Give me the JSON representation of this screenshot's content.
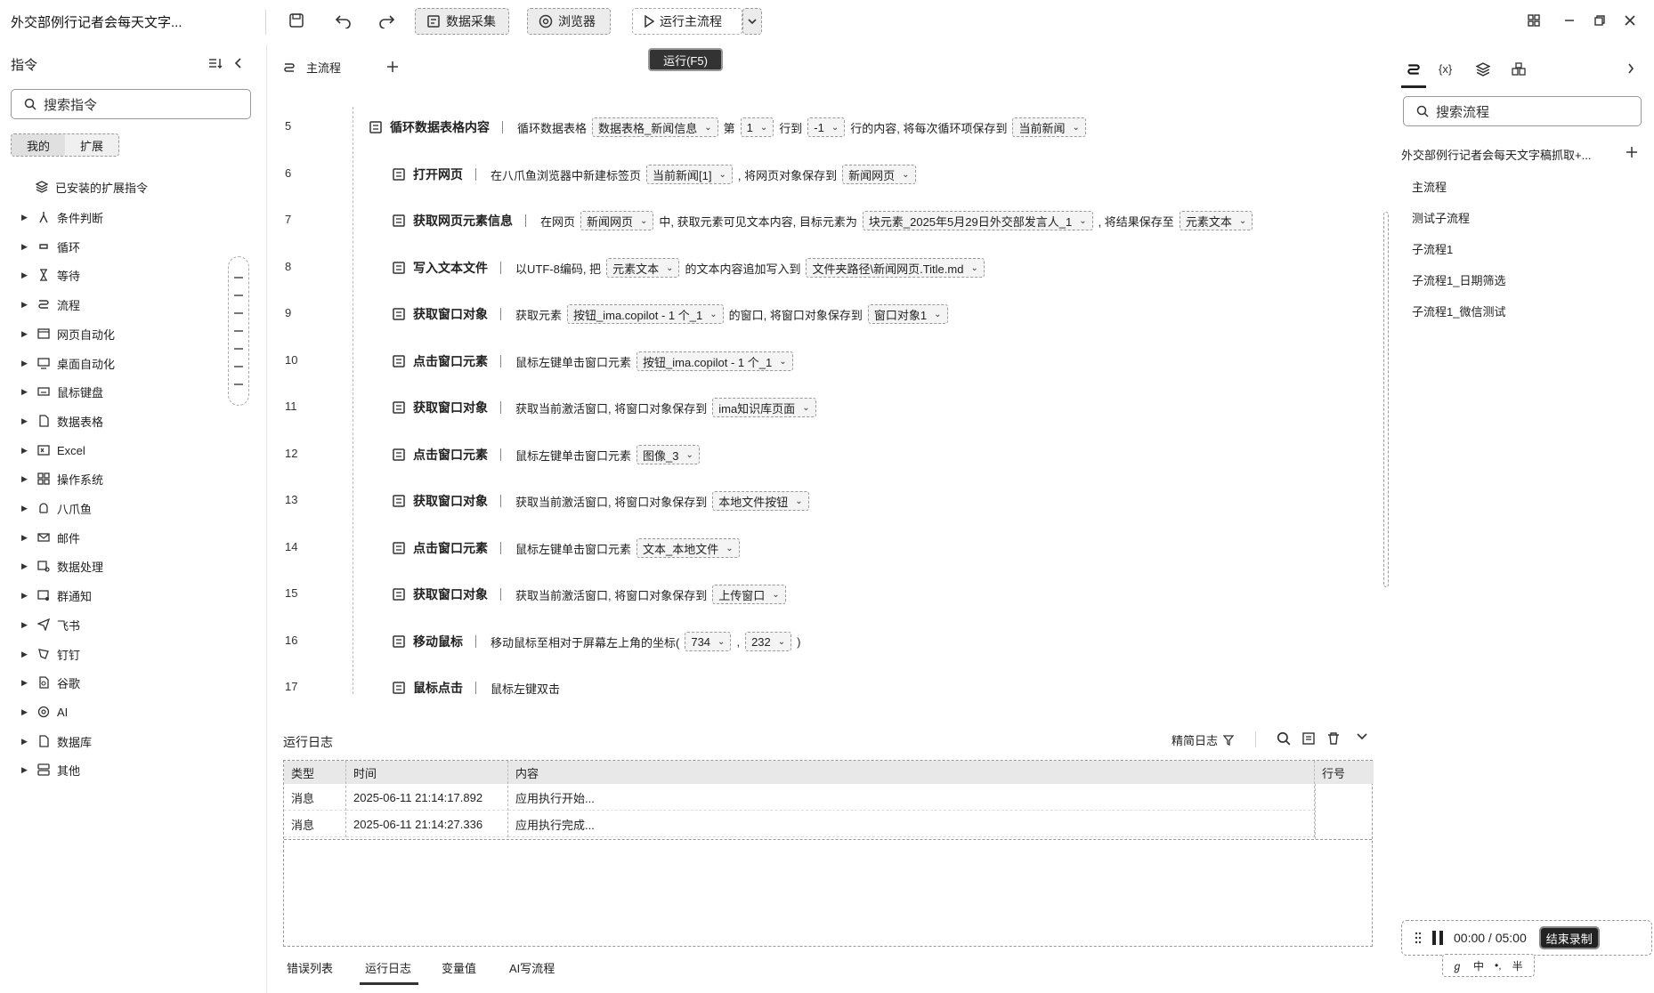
{
  "app": {
    "title": "外交部例行记者会每天文字..."
  },
  "toolbar": {
    "data_collect": "数据采集",
    "browser": "浏览器",
    "run_main": "运行主流程",
    "tooltip": "运行(F5)"
  },
  "left": {
    "header": "指令",
    "search_placeholder": "搜索指令",
    "tabs": [
      "我的",
      "扩展"
    ],
    "installed": "已安装的扩展指令",
    "items": [
      "条件判断",
      "循环",
      "等待",
      "流程",
      "网页自动化",
      "桌面自动化",
      "鼠标键盘",
      "数据表格",
      "Excel",
      "操作系统",
      "八爪鱼",
      "邮件",
      "数据处理",
      "群通知",
      "飞书",
      "钉钉",
      "谷歌",
      "AI",
      "数据库",
      "其他"
    ]
  },
  "main": {
    "tab": "主流程",
    "steps": [
      {
        "n": "5",
        "name": "循环数据表格内容",
        "t1": "循环数据表格",
        "p1": "数据表格_新闻信息",
        "t2": "第",
        "p2": "1",
        "t3": "行到",
        "p3": "-1",
        "t4": "行的内容, 将每次循环项保存到",
        "p4": "当前新闻"
      },
      {
        "n": "6",
        "name": "打开网页",
        "t1": "在八爪鱼浏览器中新建标签页",
        "p1": "当前新闻[1]",
        "t2": ", 将网页对象保存到",
        "p2": "新闻网页"
      },
      {
        "n": "7",
        "name": "获取网页元素信息",
        "t1": "在网页",
        "p1": "新闻网页",
        "t2": "中, 获取元素可见文本内容, 目标元素为",
        "p2": "块元素_2025年5月29日外交部发言人_1",
        "t3": ", 将结果保存至",
        "p3": "元素文本"
      },
      {
        "n": "8",
        "name": "写入文本文件",
        "t1": "以UTF-8编码, 把",
        "p1": "元素文本",
        "t2": "的文本内容追加写入到",
        "p2": "文件夹路径\\新闻网页.Title.md"
      },
      {
        "n": "9",
        "name": "获取窗口对象",
        "t1": "获取元素",
        "p1": "按钮_ima.copilot - 1 个_1",
        "t2": "的窗口, 将窗口对象保存到",
        "p2": "窗口对象1"
      },
      {
        "n": "10",
        "name": "点击窗口元素",
        "t1": "鼠标左键单击窗口元素",
        "p1": "按钮_ima.copilot - 1 个_1"
      },
      {
        "n": "11",
        "name": "获取窗口对象",
        "t1": "获取当前激活窗口, 将窗口对象保存到",
        "p1": "ima知识库页面"
      },
      {
        "n": "12",
        "name": "点击窗口元素",
        "t1": "鼠标左键单击窗口元素",
        "p1": "图像_3"
      },
      {
        "n": "13",
        "name": "获取窗口对象",
        "t1": "获取当前激活窗口, 将窗口对象保存到",
        "p1": "本地文件按钮"
      },
      {
        "n": "14",
        "name": "点击窗口元素",
        "t1": "鼠标左键单击窗口元素",
        "p1": "文本_本地文件"
      },
      {
        "n": "15",
        "name": "获取窗口对象",
        "t1": "获取当前激活窗口, 将窗口对象保存到",
        "p1": "上传窗口"
      },
      {
        "n": "16",
        "name": "移动鼠标",
        "t1": "移动鼠标至相对于屏幕左上角的坐标(",
        "p1": "734",
        "t2": ",",
        "p2": "232",
        "t3": ")"
      },
      {
        "n": "17",
        "name": "鼠标点击",
        "t1": "鼠标左键双击"
      }
    ]
  },
  "log": {
    "title": "运行日志",
    "filter": "精简日志",
    "headers": [
      "类型",
      "时间",
      "内容",
      "行号"
    ],
    "rows": [
      {
        "type": "消息",
        "time": "2025-06-11 21:14:17.892",
        "content": "应用执行开始..."
      },
      {
        "type": "消息",
        "time": "2025-06-11 21:14:27.336",
        "content": "应用执行完成..."
      }
    ],
    "tabs": [
      "错误列表",
      "运行日志",
      "变量值",
      "AI写流程"
    ]
  },
  "right": {
    "search_placeholder": "搜索流程",
    "project": "外交部例行记者会每天文字稿抓取+...",
    "flows": [
      "主流程",
      "测试子流程",
      "子流程1",
      "子流程1_日期筛选",
      "子流程1_微信测试"
    ]
  },
  "recorder": {
    "time": "00:00 / 05:00",
    "end": "结束录制",
    "ime": [
      "中",
      "•,",
      "半"
    ]
  }
}
